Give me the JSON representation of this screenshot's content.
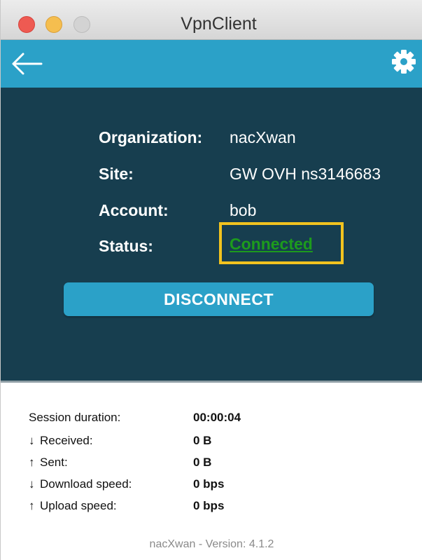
{
  "window": {
    "title": "VpnClient"
  },
  "toolbar": {
    "back_icon": "arrow-left-icon",
    "settings_icon": "gear-icon"
  },
  "info": {
    "organization_label": "Organization:",
    "organization_value": "nacXwan",
    "site_label": "Site:",
    "site_value": "GW OVH ns3146683",
    "account_label": "Account:",
    "account_value": "bob",
    "status_label": "Status:",
    "status_value": "Connected"
  },
  "actions": {
    "disconnect_label": "DISCONNECT"
  },
  "stats": {
    "session_label": "Session duration:",
    "session_value": "00:00:04",
    "received_arrow": "↓",
    "received_label": "Received:",
    "received_value": "0 B",
    "sent_arrow": "↑",
    "sent_label": "Sent:",
    "sent_value": "0 B",
    "download_arrow": "↓",
    "download_label": "Download speed:",
    "download_value": "0 bps",
    "upload_arrow": "↑",
    "upload_label": "Upload speed:",
    "upload_value": "0 bps"
  },
  "footer": {
    "version_text": "nacXwan - Version: 4.1.2"
  },
  "colors": {
    "toolbar": "#2ba1c8",
    "panel": "#173e4f",
    "status_connected": "#1d9b1d",
    "highlight_box": "#f2c31f"
  }
}
